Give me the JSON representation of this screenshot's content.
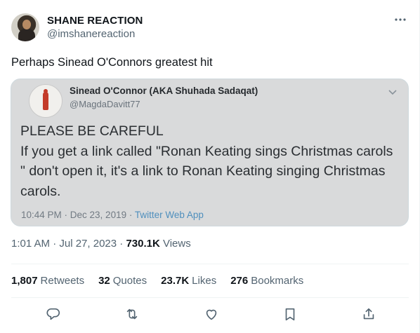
{
  "author": {
    "display_name": "SHANE REACTION",
    "handle": "@imshanereaction"
  },
  "tweet": {
    "text": "Perhaps Sinead O'Connors greatest hit",
    "timestamp": "1:01 AM · Jul 27, 2023 · ",
    "views_count": "730.1K",
    "views_label": " Views"
  },
  "quoted": {
    "display_name": "Sinead O'Connor (AKA Shuhada Sadaqat)",
    "handle": "@MagdaDavitt77",
    "line1": "PLEASE BE CAREFUL",
    "line2": "If you get a link called \"Ronan Keating sings Christmas carols \" don't open it, it's a link to Ronan Keating singing Christmas carols.",
    "meta": "10:44 PM · Dec 23, 2019 · ",
    "source": "Twitter Web App"
  },
  "stats": [
    {
      "count": "1,807",
      "label": "Retweets"
    },
    {
      "count": "32",
      "label": "Quotes"
    },
    {
      "count": "23.7K",
      "label": "Likes"
    },
    {
      "count": "276",
      "label": "Bookmarks"
    }
  ],
  "icons": {
    "more": "more-dots-icon",
    "reply": "reply-icon",
    "retweet": "retweet-icon",
    "like": "heart-icon",
    "bookmark": "bookmark-icon",
    "share": "share-icon",
    "quoted_menu": "chevron-down-icon"
  },
  "colors": {
    "text": "#0f1419",
    "secondary": "#536471",
    "quoted_background": "#d9dadb",
    "link": "#4f8fbd"
  }
}
